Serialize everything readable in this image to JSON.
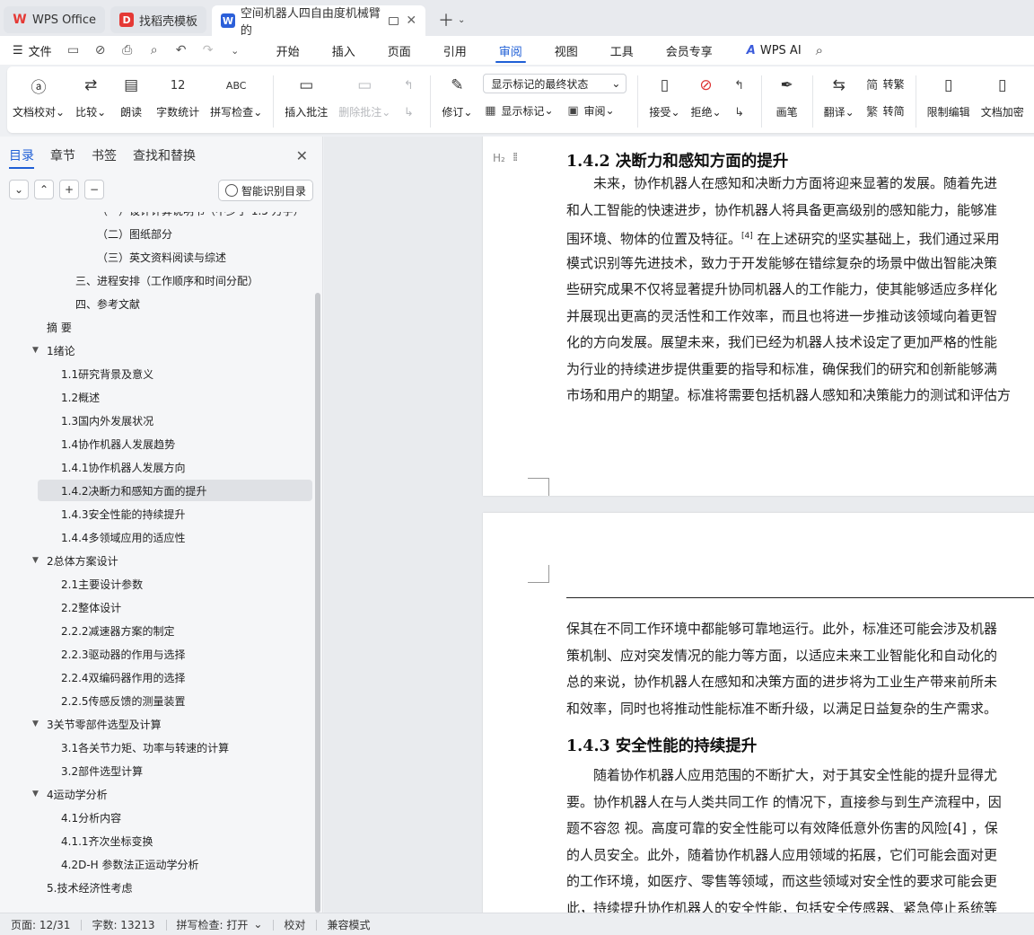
{
  "tabs": [
    {
      "label": "WPS Office",
      "state": "inactive",
      "icon": "wps-logo-icon",
      "color": "#e53935"
    },
    {
      "label": "找稻壳模板",
      "state": "inactive",
      "icon": "docer-icon",
      "color": "#e53935"
    },
    {
      "label": "空间机器人四自由度机械臂的",
      "state": "active",
      "icon": "writer-icon",
      "color": "#2b5fd9"
    }
  ],
  "menubar": {
    "file_label": "文件",
    "tabs": [
      "开始",
      "插入",
      "页面",
      "引用",
      "审阅",
      "视图",
      "工具",
      "会员专享"
    ],
    "active_tab": "审阅",
    "ai_label": "WPS AI"
  },
  "ribbon": {
    "proofread": "文档校对",
    "compare": "比较",
    "read_aloud": "朗读",
    "word_count": "字数统计",
    "spell_check": "拼写检查",
    "insert_comment": "插入批注",
    "delete_comment": "删除批注",
    "track_changes": "修订",
    "display_mode": "显示标记的最终状态",
    "show_markup": "显示标记",
    "review": "审阅",
    "accept": "接受",
    "reject": "拒绝",
    "ink": "画笔",
    "translate": "翻译",
    "to_traditional": "转繁",
    "to_simplified": "转简",
    "restrict_editing": "限制编辑",
    "doc_encrypt": "文档加密"
  },
  "sidebar": {
    "tabs": [
      "目录",
      "章节",
      "书签",
      "查找和替换"
    ],
    "active_tab": "目录",
    "smart_toc": "智能识别目录",
    "items": [
      {
        "label": "（一）设计计算说明书（不少于 1.5 万字）",
        "level": 3,
        "caret": false
      },
      {
        "label": "（二）图纸部分",
        "level": 3,
        "caret": false
      },
      {
        "label": "（三）英文资料阅读与综述",
        "level": 3,
        "caret": false
      },
      {
        "label": "三、进程安排（工作顺序和时间分配）",
        "level": 2,
        "caret": false
      },
      {
        "label": "四、参考文献",
        "level": 2,
        "caret": false
      },
      {
        "label": "摘  要",
        "level": 1,
        "caret": false
      },
      {
        "label": "1绪论",
        "level": 1,
        "caret": true
      },
      {
        "label": "1.1研究背景及意义",
        "level": 2,
        "caret": false
      },
      {
        "label": "1.2概述",
        "level": 2,
        "caret": false
      },
      {
        "label": "1.3国内外发展状况",
        "level": 2,
        "caret": false
      },
      {
        "label": "1.4协作机器人发展趋势",
        "level": 2,
        "caret": false
      },
      {
        "label": "1.4.1协作机器人发展方向",
        "level": 2,
        "caret": false
      },
      {
        "label": "1.4.2决断力和感知方面的提升",
        "level": 2,
        "caret": false,
        "selected": true
      },
      {
        "label": "1.4.3安全性能的持续提升",
        "level": 2,
        "caret": false
      },
      {
        "label": "1.4.4多领域应用的适应性",
        "level": 2,
        "caret": false
      },
      {
        "label": "2总体方案设计",
        "level": 1,
        "caret": true
      },
      {
        "label": "2.1主要设计参数",
        "level": 2,
        "caret": false
      },
      {
        "label": "2.2整体设计",
        "level": 2,
        "caret": false
      },
      {
        "label": "2.2.2减速器方案的制定",
        "level": 2,
        "caret": false
      },
      {
        "label": "2.2.3驱动器的作用与选择",
        "level": 2,
        "caret": false
      },
      {
        "label": "2.2.4双编码器作用的选择",
        "level": 2,
        "caret": false
      },
      {
        "label": "2.2.5传感反馈的测量装置",
        "level": 2,
        "caret": false
      },
      {
        "label": "3关节零部件选型及计算",
        "level": 1,
        "caret": true
      },
      {
        "label": "3.1各关节力矩、功率与转速的计算",
        "level": 2,
        "caret": false
      },
      {
        "label": "3.2部件选型计算",
        "level": 2,
        "caret": false
      },
      {
        "label": "4运动学分析",
        "level": 1,
        "caret": true
      },
      {
        "label": "4.1分析内容",
        "level": 2,
        "caret": false
      },
      {
        "label": "4.1.1齐次坐标变换",
        "level": 2,
        "caret": false
      },
      {
        "label": "4.2D-H 参数法正运动学分析",
        "level": 2,
        "caret": false
      },
      {
        "label": "5.技术经济性考虑",
        "level": 1,
        "caret": false
      }
    ]
  },
  "document": {
    "heading1_mark": "H₂",
    "heading1": "1.4.2 决断力和感知方面的提升",
    "para1": [
      "　　未来，协作机器人在感知和决断力方面将迎来显著的发展。随着先进",
      "和人工智能的快速进步，协作机器人将具备更高级别的感知能力，能够准",
      "围环境、物体的位置及特征。",
      "模式识别等先进技术，致力于开发能够在错综复杂的场景中做出智能决策",
      "些研究成果不仅将显著提升协同机器人的工作能力，使其能够适应多样化",
      "并展现出更高的灵活性和工作效率，而且也将进一步推动该领域向着更智",
      "化的方向发展。展望未来，我们已经为机器人技术设定了更加严格的性能",
      "为行业的持续进步提供重要的指导和标准，确保我们的研究和创新能够满",
      "市场和用户的期望。标准将需要包括机器人感知和决策能力的测试和评估方"
    ],
    "cite1": "[4]",
    "para1_line3_tail": " 在上述研究的坚实基础上，我们通过采用",
    "para2": [
      "保其在不同工作环境中都能够可靠地运行。此外，标准还可能会涉及机器",
      "策机制、应对突发情况的能力等方面，以适应未来工业智能化和自动化的",
      "总的来说，协作机器人在感知和决策方面的进步将为工业生产带来前所未",
      "和效率，同时也将推动性能标准不断升级，以满足日益复杂的生产需求。"
    ],
    "heading2": "1.4.3 安全性能的持续提升",
    "para3": [
      "　　随着协作机器人应用范围的不断扩大，对于其安全性能的提升显得尤",
      "要。协作机器人在与人类共同工作  的情况下，直接参与到生产流程中，因",
      "题不容忽  视。高度可靠的安全性能可以有效降低意外伤害的风险[4] ，保",
      "的人员安全。此外，随着协作机器人应用领域的拓展，它们可能会面对更",
      "的工作环境，如医疗、零售等领域，而这些领域对安全性的要求可能会更",
      "此，持续提升协作机器人的安全性能，包括安全传感器、紧急停止系统等"
    ]
  },
  "status": {
    "page": "页面: 12/31",
    "words": "字数: 13213",
    "spell": "拼写检查: 打开",
    "proof": "校对",
    "compat": "兼容模式"
  }
}
